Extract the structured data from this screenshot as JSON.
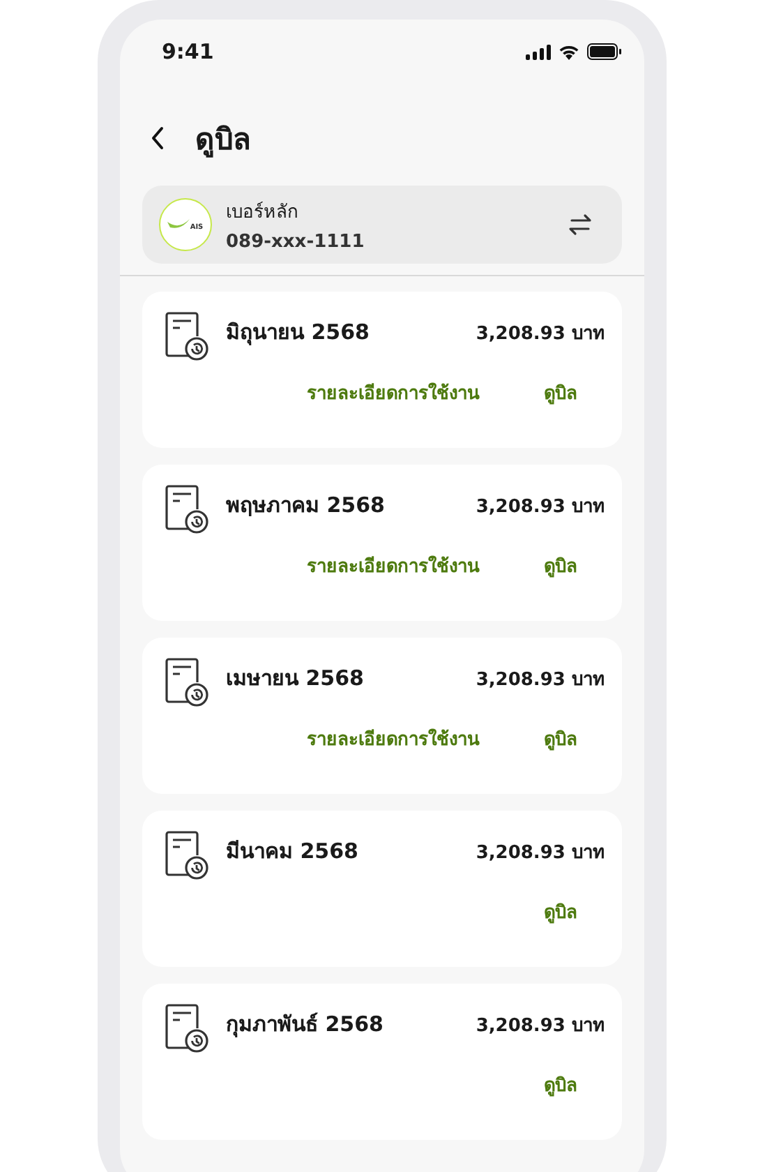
{
  "status_bar": {
    "time": "9:41"
  },
  "header": {
    "title": "ดูบิล"
  },
  "account": {
    "logo_text": "AIS",
    "label": "เบอร์หลัก",
    "number": "089-xxx-1111"
  },
  "bills": [
    {
      "month": "มิถุนายน 2568",
      "amount": "3,208.93 บาท",
      "links": [
        "รายละเอียดการใช้งาน",
        "ดูบิล"
      ]
    },
    {
      "month": "พฤษภาคม 2568",
      "amount": "3,208.93 บาท",
      "links": [
        "รายละเอียดการใช้งาน",
        "ดูบิล"
      ]
    },
    {
      "month": "เมษายน 2568",
      "amount": "3,208.93 บาท",
      "links": [
        "รายละเอียดการใช้งาน",
        "ดูบิล"
      ]
    },
    {
      "month": "มีนาคม 2568",
      "amount": "3,208.93 บาท",
      "links": [
        "ดูบิล"
      ]
    },
    {
      "month": "กุมภาพันธ์ 2568",
      "amount": "3,208.93 บาท",
      "links": [
        "ดูบิล"
      ]
    }
  ]
}
